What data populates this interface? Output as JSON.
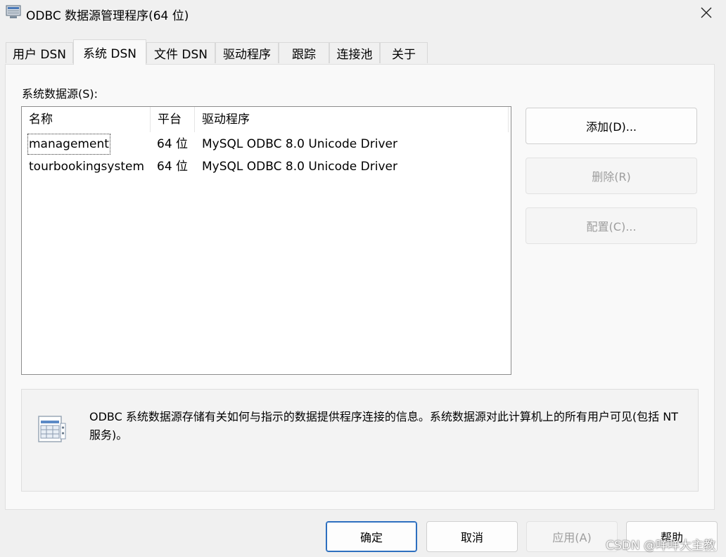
{
  "window": {
    "title": "ODBC 数据源管理程序(64 位)"
  },
  "tabs": [
    {
      "label": "用户 DSN"
    },
    {
      "label": "系统 DSN",
      "active": true
    },
    {
      "label": "文件 DSN"
    },
    {
      "label": "驱动程序"
    },
    {
      "label": "跟踪"
    },
    {
      "label": "连接池"
    },
    {
      "label": "关于"
    }
  ],
  "system_dsn": {
    "section_label": "系统数据源(S):",
    "columns": {
      "name": "名称",
      "platform": "平台",
      "driver": "驱动程序"
    },
    "rows": [
      {
        "name": "management",
        "platform": "64 位",
        "driver": "MySQL ODBC 8.0 Unicode Driver"
      },
      {
        "name": "tourbookingsystem",
        "platform": "64 位",
        "driver": "MySQL ODBC 8.0 Unicode Driver"
      }
    ],
    "buttons": {
      "add": "添加(D)...",
      "remove": "删除(R)",
      "configure": "配置(C)..."
    },
    "info_text": "ODBC 系统数据源存储有关如何与指示的数据提供程序连接的信息。系统数据源对此计算机上的所有用户可见(包括 NT 服务)。"
  },
  "dialog_buttons": {
    "ok": "确定",
    "cancel": "取消",
    "apply": "应用(A)",
    "help": "帮助"
  },
  "watermark": "CSDN @咩咩大主教",
  "colors": {
    "accent": "#2d6fbf",
    "disabled_text": "#9d9d9d"
  }
}
